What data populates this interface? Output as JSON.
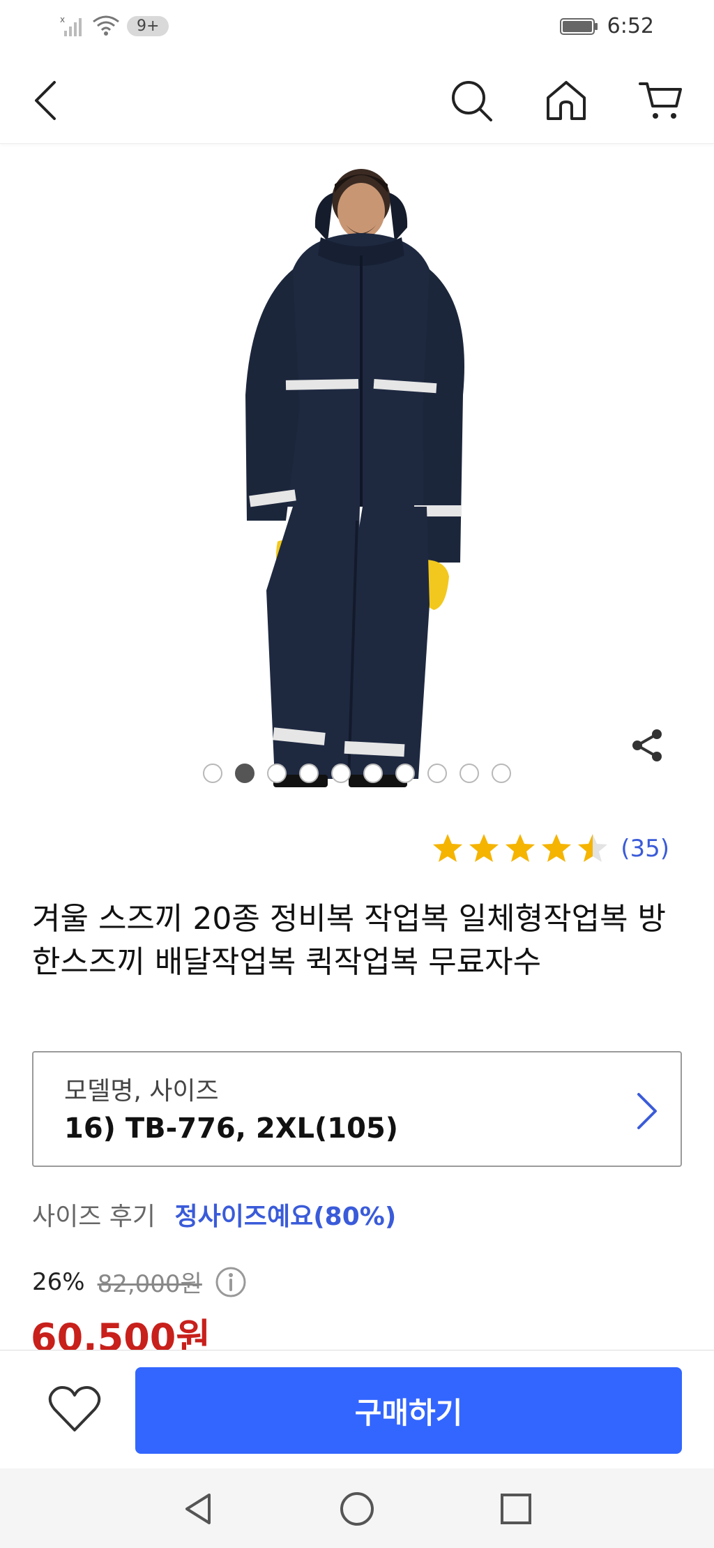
{
  "status_bar": {
    "notification_badge": "9+",
    "time": "6:52"
  },
  "header": {
    "icons": [
      "back-icon",
      "search-icon",
      "home-icon",
      "cart-icon"
    ]
  },
  "gallery": {
    "total_images": 10,
    "active_index": 1
  },
  "rating": {
    "stars": 4.5,
    "count": "(35)",
    "star_color": "#f5b400"
  },
  "product": {
    "title": "겨울 스즈끼 20종 정비복 작업복 일체형작업복 방한스즈끼 배달작업복 퀵작업복 무료자수"
  },
  "option": {
    "label": "모델명, 사이즈",
    "value": "16) TB-776, 2XL(105)"
  },
  "size_review": {
    "label": "사이즈 후기",
    "value": "정사이즈예요(80%)"
  },
  "price": {
    "discount": "26%",
    "original": "82,000원",
    "final": "60,500원"
  },
  "actions": {
    "buy_label": "구매하기",
    "accent": "#3366ff"
  }
}
